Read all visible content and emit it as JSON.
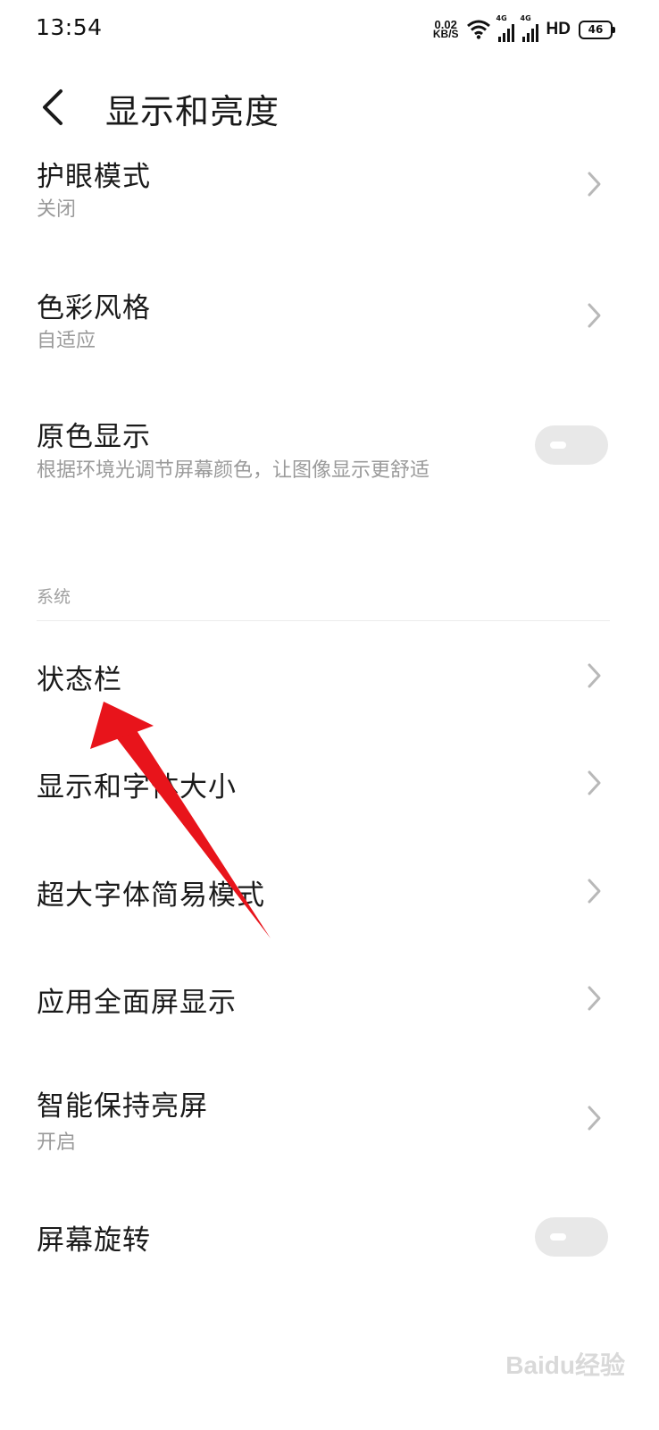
{
  "status_bar": {
    "time": "13:54",
    "net_speed_value": "0.02",
    "net_speed_unit": "KB/S",
    "signal_tag_1": "4G",
    "signal_tag_2": "4G",
    "hd_label": "HD",
    "battery": "46",
    "icons": [
      "wifi-icon",
      "signal-icon",
      "signal-icon",
      "battery-icon"
    ]
  },
  "header": {
    "title": "显示和亮度",
    "back_icon": "back-arrow-icon"
  },
  "settings": {
    "eye_care": {
      "title": "护眼模式",
      "subtitle": "关闭"
    },
    "color_style": {
      "title": "色彩风格",
      "subtitle": "自适应"
    },
    "true_tone": {
      "title": "原色显示",
      "subtitle": "根据环境光调节屏幕颜色，让图像显示更舒适",
      "toggle_on": false
    },
    "section_system": "系统",
    "status_bar": {
      "title": "状态栏"
    },
    "display_font_size": {
      "title": "显示和字体大小"
    },
    "large_font_mode": {
      "title": "超大字体简易模式"
    },
    "fullscreen_apps": {
      "title": "应用全面屏显示"
    },
    "smart_stay_awake": {
      "title": "智能保持亮屏",
      "subtitle": "开启"
    },
    "auto_rotate": {
      "title": "屏幕旋转",
      "toggle_on": false
    }
  },
  "annotation": {
    "arrow_color": "#e8141b"
  },
  "watermark": {
    "text": "Baidu经验"
  },
  "colors": {
    "text_primary": "#1a1a1a",
    "text_secondary": "#9a9a9a",
    "chevron": "#b8b8b8",
    "toggle_off": "#e8e8e8"
  }
}
